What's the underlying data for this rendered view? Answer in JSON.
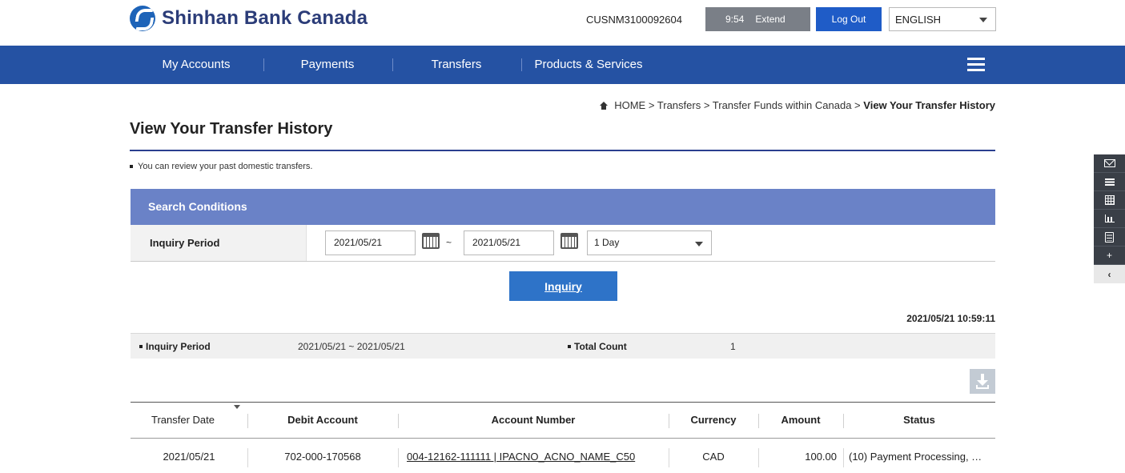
{
  "brand": {
    "name": "Shinhan Bank Canada",
    "logo_icon": "shinhan-logo-icon",
    "color": "#1d63b8"
  },
  "header": {
    "user_id": "CUSNM3100092604",
    "session_time": "9:54",
    "extend_label": "Extend",
    "logout_label": "Log Out",
    "language": "ENGLISH"
  },
  "nav": {
    "items": [
      {
        "label": "My Accounts"
      },
      {
        "label": "Payments"
      },
      {
        "label": "Transfers"
      },
      {
        "label": "Products & Services"
      }
    ],
    "menu_icon": "hamburger-icon",
    "color": "#2552a3"
  },
  "breadcrumb": {
    "home": "HOME",
    "path": " > Transfers > Transfer Funds within Canada > ",
    "current": "View Your Transfer History"
  },
  "page": {
    "title": "View Your Transfer History",
    "note": "You can review your past domestic transfers."
  },
  "search": {
    "heading": "Search Conditions",
    "period_label": "Inquiry Period",
    "from_date": "2021/05/21",
    "separator": "~",
    "to_date": "2021/05/21",
    "period_option": "1 Day",
    "inquiry_label": "Inquiry"
  },
  "result": {
    "timestamp": "2021/05/21 10:59:11",
    "period_label": "Inquiry Period",
    "period_value": "2021/05/21 ~ 2021/05/21",
    "count_label": "Total Count",
    "count_value": "1"
  },
  "table": {
    "headers": [
      "Transfer Date",
      "Debit Account",
      "Account Number",
      "Currency",
      "Amount",
      "Status"
    ],
    "rows": [
      {
        "date": "2021/05/21",
        "debit_account": "702-000-170568",
        "account_number": "004-12162-111111 | IPACNO_ACNO_NAME_C50",
        "currency": "CAD",
        "amount": "100.00",
        "status": "(10) Payment Processing, …"
      }
    ]
  },
  "quick_menu": {
    "items": [
      "mail-icon",
      "list-icon",
      "calculator-icon",
      "chart-icon",
      "document-icon",
      "plus-icon",
      "collapse-arrow-icon"
    ],
    "plus": "+",
    "collapse": "‹"
  }
}
